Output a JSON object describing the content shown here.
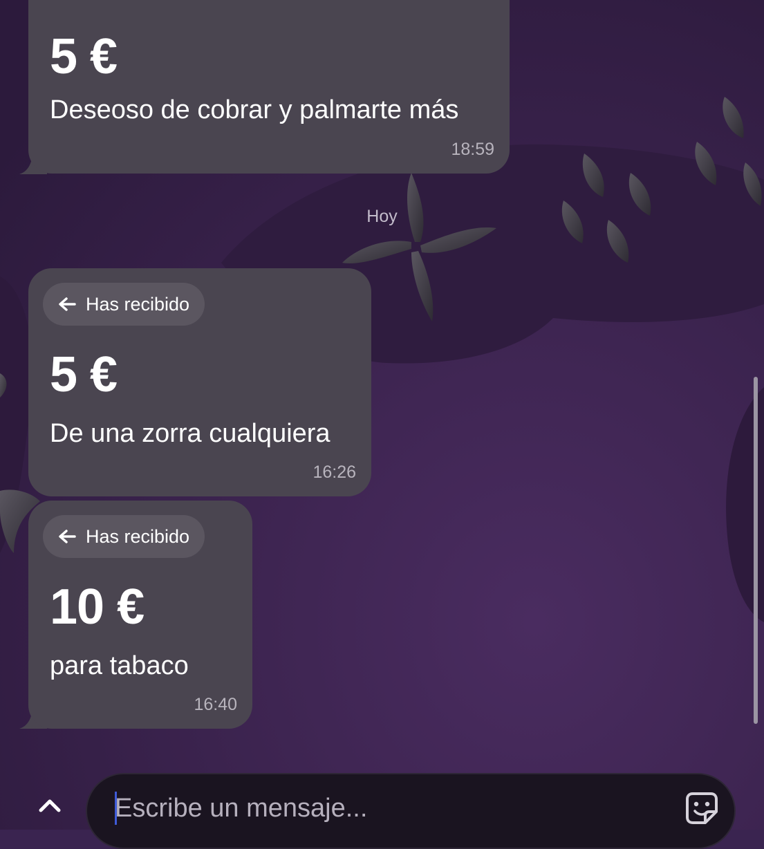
{
  "chat": {
    "day_separator": "Hoy",
    "messages": [
      {
        "amount": "5 €",
        "note": "Deseoso de cobrar y palmarte más",
        "time": "18:59"
      },
      {
        "direction_label": "Has recibido",
        "amount": "5 €",
        "note": "De una zorra cualquiera",
        "time": "16:26"
      },
      {
        "direction_label": "Has recibido",
        "amount": "10 €",
        "note": "para tabaco",
        "time": "16:40"
      }
    ]
  },
  "composer": {
    "placeholder": "Escribe un mensaje...",
    "expand_icon": "chevron-up-icon",
    "sticker_icon": "sticker-icon"
  },
  "colors": {
    "background": "#3a2450",
    "bubble": "#4a4550",
    "pill": "#5b5660",
    "timestamp": "#b8b4bd",
    "input_background": "#1a1420",
    "caret": "#3f5bd8"
  }
}
